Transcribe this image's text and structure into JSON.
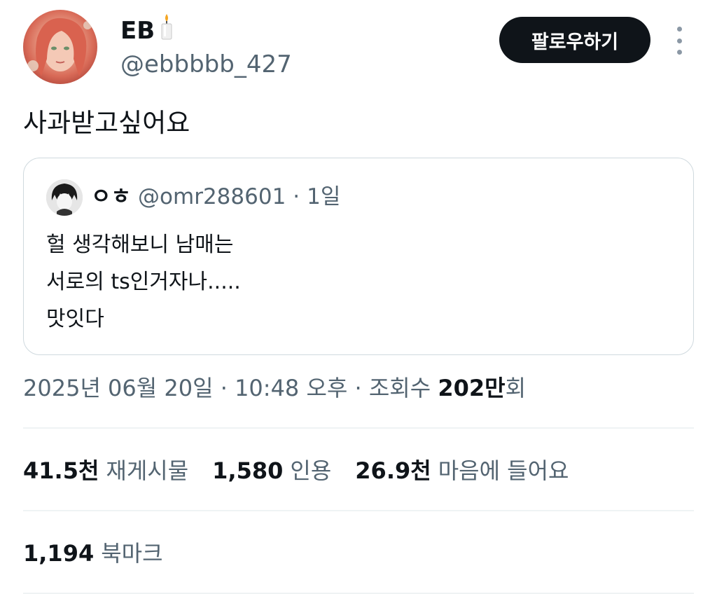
{
  "author": {
    "display_name": "EB",
    "name_emoji_icon": "candle-icon",
    "handle": "@ebbbbb_427"
  },
  "follow_label": "팔로우하기",
  "tweet_text": "사과받고싶어요",
  "quoted": {
    "display_name": "ㅇㅎ",
    "handle": "@omr288601",
    "time": "1일",
    "lines": [
      "헐 생각해보니 남매는",
      "서로의 ts인거자나.....",
      "맛잇다"
    ]
  },
  "meta": {
    "date": "2025년 06월 20일",
    "time": "10:48 오후",
    "views_prefix": "조회수",
    "views_number": "202만",
    "views_suffix": "회"
  },
  "stats": {
    "reposts": {
      "value": "41.5천",
      "label": "재게시물"
    },
    "quotes": {
      "value": "1,580",
      "label": "인용"
    },
    "likes": {
      "value": "26.9천",
      "label": "마음에 들어요"
    },
    "bookmarks": {
      "value": "1,194",
      "label": "북마크"
    }
  },
  "colors": {
    "text": "#0f1419",
    "secondary": "#536471",
    "border": "#cfd9de",
    "button": "#0f1419"
  }
}
